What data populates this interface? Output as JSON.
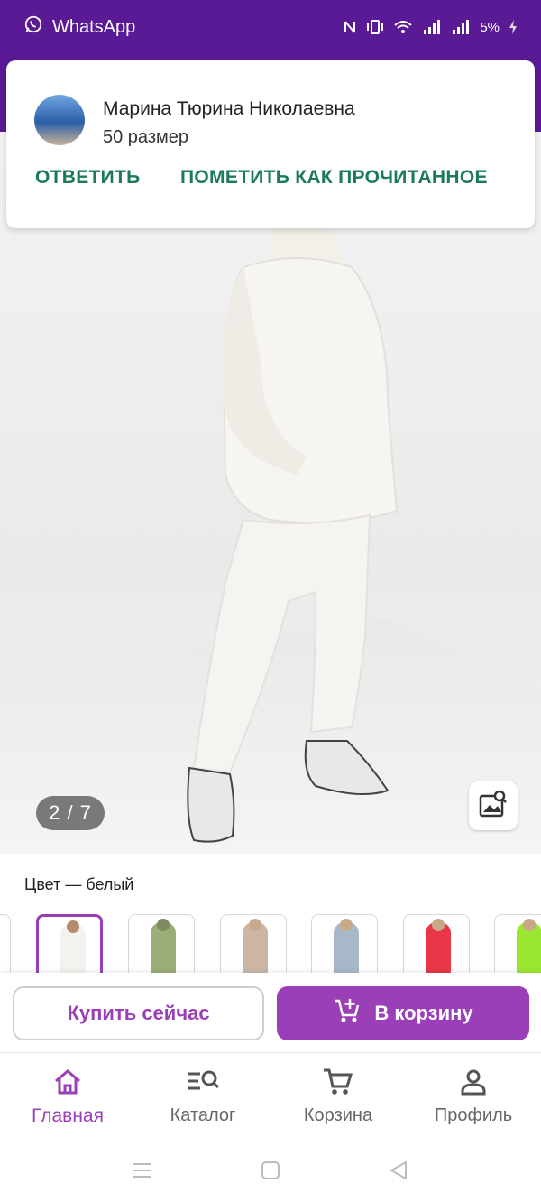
{
  "status_bar": {
    "app_name": "WhatsApp",
    "battery": "5%",
    "background_color": "#5a1a96"
  },
  "notification": {
    "sender": "Марина Тюрина Николаевна",
    "message": "50 размер",
    "actions": [
      "ОТВЕТИТЬ",
      "ПОМЕТИТЬ КАК ПРОЧИТАННОЕ"
    ],
    "action_color": "#1a7a5a"
  },
  "product": {
    "image_counter": "2 / 7",
    "color_label": "Цвет — белый",
    "swatches": [
      {
        "color": "#f4f2ee",
        "selected": true
      },
      {
        "color": "#9bae78",
        "selected": false
      },
      {
        "color": "#cbb6a6",
        "selected": false
      },
      {
        "color": "#a9b8c8",
        "selected": false
      },
      {
        "color": "#e83848",
        "selected": false
      },
      {
        "color": "#9ae630",
        "selected": false
      }
    ]
  },
  "actions": {
    "buy_now": "Купить сейчас",
    "add_to_cart": "В корзину",
    "accent_color": "#9b3fb8"
  },
  "bottom_nav": {
    "items": [
      {
        "label": "Главная",
        "icon": "home-icon",
        "active": true
      },
      {
        "label": "Каталог",
        "icon": "catalog-search-icon",
        "active": false
      },
      {
        "label": "Корзина",
        "icon": "cart-icon",
        "active": false
      },
      {
        "label": "Профиль",
        "icon": "profile-icon",
        "active": false
      }
    ]
  },
  "system_nav": {
    "icons": [
      "menu-icon",
      "home-square-icon",
      "back-triangle-icon"
    ]
  }
}
